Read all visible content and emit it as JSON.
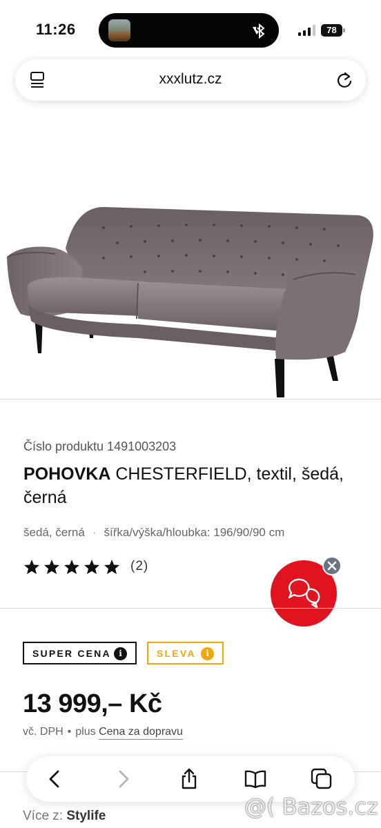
{
  "status_bar": {
    "time": "11:26",
    "battery": "78"
  },
  "browser": {
    "url": "xxxlutz.cz"
  },
  "product": {
    "number_label": "Číslo produktu 1491003203",
    "title_brand": "POHOVKA",
    "title_rest": " CHESTERFIELD, textil, šedá, černá",
    "color": "šedá, černá",
    "dimensions": "šířka/výška/hloubka: 196/90/90 cm",
    "rating_stars": 5,
    "rating_count": "(2)"
  },
  "badges": {
    "super_cena": "SUPER CENA",
    "sleva": "SLEVA",
    "info_glyph": "i"
  },
  "pricing": {
    "price": "13 999,– Kč",
    "vat_note": "vč. DPH",
    "plus": "plus",
    "shipping_link": "Cena za dopravu"
  },
  "footer": {
    "more_from": "Více z:",
    "brand": "Stylife"
  },
  "watermark": "@( Bazos.cz",
  "colors": {
    "accent_red": "#e0131f",
    "sleva_orange": "#f2a800",
    "star": "#111111"
  },
  "icons": {
    "tabs": "tabs-icon",
    "reload": "reload-icon",
    "chat": "chat-icon",
    "close": "close-icon",
    "back": "back-icon",
    "forward": "forward-icon",
    "share": "share-icon",
    "bookmarks": "bookmarks-icon",
    "tab_switcher": "tab-switcher-icon"
  }
}
